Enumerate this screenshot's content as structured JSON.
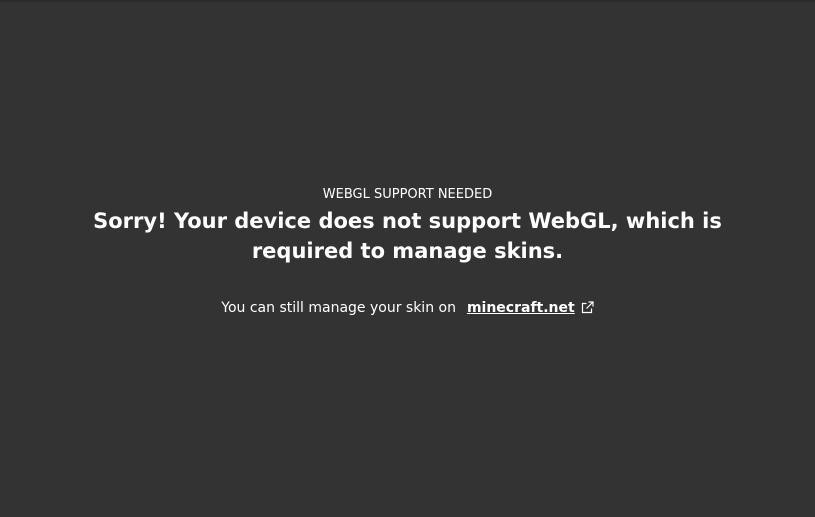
{
  "colors": {
    "background": "#333333",
    "text": "#ffffff"
  },
  "notice": {
    "eyebrow": "WEBGL SUPPORT NEEDED",
    "headline": "Sorry! Your device does not support WebGL, which is required to manage skins.",
    "subline_text": "You can still manage your skin on",
    "link_label": "minecraft.net",
    "link_icon": "external-link-icon"
  }
}
